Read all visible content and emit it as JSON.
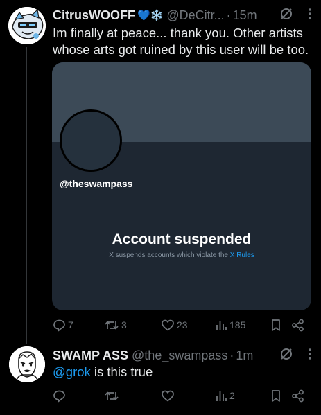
{
  "post1": {
    "display_name": "CitrusWOOFF",
    "badge_emoji": "💙❄️",
    "handle": "@DeCitr...",
    "separator": "·",
    "time": "15m",
    "text": "Im finally at peace... thank you. Other artists whose arts got ruined by this user will be too.",
    "card": {
      "handle": "@theswampass",
      "title": "Account suspended",
      "subtitle_prefix": "X suspends accounts which violate the ",
      "subtitle_link": "X Rules"
    },
    "actions": {
      "replies": "7",
      "reposts": "3",
      "likes": "23",
      "views": "185"
    }
  },
  "post2": {
    "display_name": "SWAMP ASS",
    "handle": "@the_swampass",
    "separator": "·",
    "time": "1m",
    "mention": "@grok",
    "text_rest": " is this true",
    "actions": {
      "replies": "",
      "reposts": "",
      "likes": "",
      "views": "2"
    }
  },
  "colors": {
    "background": "#000000",
    "text": "#e7e9ea",
    "secondary": "#71767b",
    "accent": "#1d9bf0",
    "card_bg": "#1e2732",
    "card_banner": "#3c4a57"
  },
  "icons": [
    "grok-icon",
    "more-icon",
    "reply-icon",
    "repost-icon",
    "like-icon",
    "views-icon",
    "bookmark-icon",
    "share-icon"
  ]
}
